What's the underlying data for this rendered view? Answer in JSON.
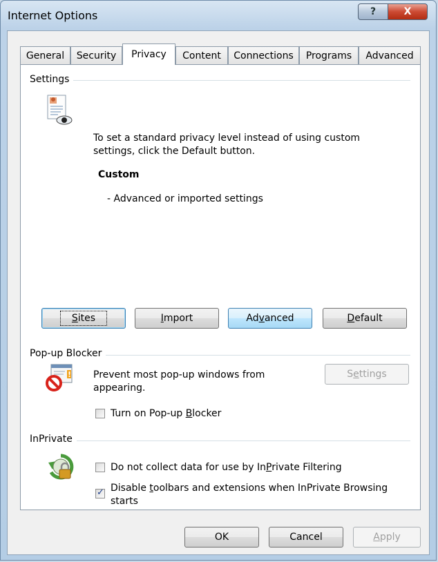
{
  "window": {
    "title": "Internet Options",
    "help_glyph": "?",
    "close_glyph": "X"
  },
  "tabs": [
    {
      "label": "General",
      "active": false
    },
    {
      "label": "Security",
      "active": false
    },
    {
      "label": "Privacy",
      "active": true
    },
    {
      "label": "Content",
      "active": false
    },
    {
      "label": "Connections",
      "active": false
    },
    {
      "label": "Programs",
      "active": false
    },
    {
      "label": "Advanced",
      "active": false
    }
  ],
  "settings": {
    "group_label": "Settings",
    "description_line1": "To set a standard privacy level instead of using custom",
    "description_line2": "settings, click the Default button.",
    "level_name": "Custom",
    "level_detail": "- Advanced or imported settings",
    "icon": "privacy-document-eye-icon",
    "buttons": {
      "sites": {
        "pre": "",
        "key": "S",
        "post": "ites"
      },
      "import": {
        "pre": "",
        "key": "I",
        "post": "mport"
      },
      "advanced": {
        "pre": "Ad",
        "key": "v",
        "post": "anced"
      },
      "default": {
        "pre": "",
        "key": "D",
        "post": "efault"
      }
    }
  },
  "popup": {
    "group_label": "Pop-up Blocker",
    "description_line1": "Prevent most pop-up windows from",
    "description_line2": "appearing.",
    "icon": "popup-blocked-icon",
    "settings_button": {
      "pre": "S",
      "key": "e",
      "post": "ttings",
      "enabled": false
    },
    "checkbox": {
      "pre": "Turn on Pop-up ",
      "key": "B",
      "post": "locker",
      "checked": false
    }
  },
  "inprivate": {
    "group_label": "InPrivate",
    "icon": "inprivate-lock-icon",
    "filter_checkbox": {
      "pre": "Do not collect data for use by In",
      "key": "P",
      "post": "rivate Filtering",
      "checked": false
    },
    "toolbar_checkbox": {
      "pre": "Disable ",
      "key": "t",
      "post": "oolbars and extensions when InPrivate Browsing",
      "line2": "starts",
      "checked": true
    }
  },
  "footer": {
    "ok": "OK",
    "cancel": "Cancel",
    "apply": {
      "pre": "",
      "key": "A",
      "post": "pply",
      "enabled": false
    }
  },
  "colors": {
    "title_bar": "#bcd2e8",
    "close_button": "#cc4a33",
    "focus_border": "#3c7fb1",
    "disabled_text": "#a0a0a0"
  }
}
